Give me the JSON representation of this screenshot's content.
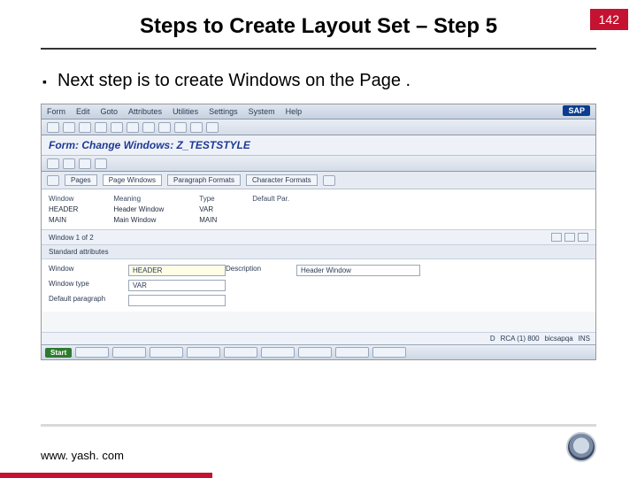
{
  "slide": {
    "title": "Steps to Create Layout Set – Step 5",
    "page_number": "142",
    "bullet": "Next step is to create Windows on the Page ."
  },
  "sap": {
    "menu": [
      "Form",
      "Edit",
      "Goto",
      "Attributes",
      "Utilities",
      "Settings",
      "System",
      "Help"
    ],
    "logo": "SAP",
    "subtitle": "Form: Change Windows: Z_TESTSTYLE",
    "tabs": [
      "Pages",
      "Page Windows",
      "Paragraph Formats",
      "Character Formats"
    ],
    "list": {
      "headers": [
        "Window",
        "Meaning",
        "Type",
        "Default Par."
      ],
      "rows": [
        [
          "HEADER",
          "Header Window",
          "VAR",
          ""
        ],
        [
          "MAIN",
          "Main Window",
          "MAIN",
          ""
        ]
      ]
    },
    "pager": "Window   1   of   2",
    "attr_title": "Standard attributes",
    "attrs": {
      "window_label": "Window",
      "window_value": "HEADER",
      "desc_label": "Description",
      "desc_value": "Header Window",
      "type_label": "Window type",
      "type_value": "VAR",
      "para_label": "Default paragraph",
      "para_value": ""
    },
    "status": [
      "D",
      "RCA (1) 800",
      "bicsapqa",
      "INS"
    ],
    "taskbar_start": "Start"
  },
  "footer": {
    "url": "www. yash. com"
  }
}
